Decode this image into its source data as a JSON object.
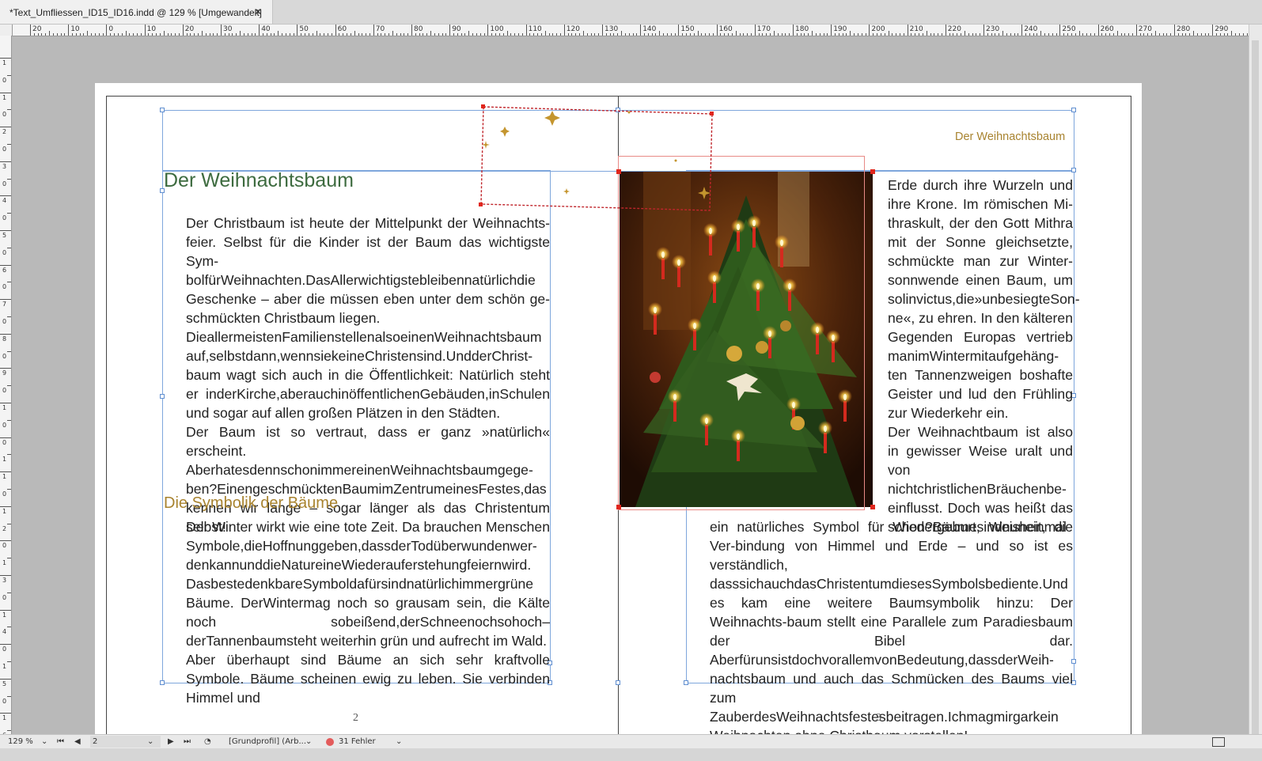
{
  "window": {
    "tab_title": "*Text_Umfliessen_ID15_ID16.indd @ 129 % [Umgewandelt]",
    "tab_close": "×"
  },
  "ruler": {
    "h_labels": [
      "20",
      "10",
      "0",
      "10",
      "20",
      "30",
      "40",
      "50",
      "60",
      "70",
      "80",
      "90",
      "100",
      "110",
      "120",
      "130",
      "140",
      "150",
      "160",
      "170",
      "180",
      "190",
      "200",
      "210",
      "220",
      "230",
      "240",
      "250",
      "260",
      "270",
      "280",
      "290"
    ],
    "v_labels": [
      "1",
      "0",
      "1",
      "0",
      "2",
      "0",
      "3",
      "0",
      "4",
      "0",
      "5",
      "0",
      "6",
      "0",
      "7",
      "0",
      "8",
      "0",
      "9",
      "0",
      "1",
      "0",
      "0",
      "1",
      "1",
      "0",
      "1",
      "2",
      "0",
      "1",
      "3",
      "0",
      "1",
      "4",
      "0",
      "1",
      "5",
      "0",
      "1",
      "6",
      "0"
    ]
  },
  "left_page": {
    "heading": "Der Weihnachtsbaum",
    "paragraphs": [
      "Der Christbaum ist heute der Mittelpunkt der Weihnachts-feier. Selbst für die Kinder ist der Baum das wichtigste Sym-bolfürWeihnachten.DasAllerwichtigstebleibennatürlichdie Geschenke – aber die müssen eben unter dem schön ge-schmückten Christbaum liegen.",
      "DieallermeistenFamilienstellenalsoeinenWeihnachtsbaum auf,selbstdann,wennsiekeineChristensind.UndderChrist-baum wagt sich auch in die Öffentlichkeit: Natürlich steht er inderKirche,aberauchinöffentlichenGebäuden,inSchulen und sogar auf allen großen Plätzen in den Städten.",
      "Der Baum ist so vertraut, dass er ganz »natürlich« erscheint. AberhatesdennschonimmereinenWeihnachtsbaumgege-ben?EinengeschmücktenBaumimZentrumeinesFestes,das kennen wir lange – sogar länger als das Christentum selbst!"
    ],
    "subheading": "Die Symbolik der Bäume",
    "paragraphs2": [
      "Der Winter wirkt wie eine tote Zeit. Da brauchen Menschen Symbole,dieHoffnunggeben,dassderTodüberwundenwer-denkannunddieNatureineWiederauferstehungfeiernwird. DasbestedenkbareSymboldafürsindnatürlichimmergrüne Bäume. DerWintermag noch so grausam sein, die Kälte noch sobeißend,derSchneenochsohoch–derTannenbaumsteht weiterhin grün und aufrecht im Wald.",
      "Aber überhaupt sind Bäume an sich sehr kraftvolle Symbole. Bäume scheinen ewig zu leben. Sie verbinden Himmel und"
    ],
    "page_number": "2"
  },
  "right_page": {
    "running_header": "Der Weihnachtsbaum",
    "column_text": [
      "Erde durch ihre Wurzeln und ihre Krone. Im römischen Mi-thraskult, der den Gott Mithra mit der Sonne gleichsetzte, schmückte man zur Winter-sonnwende einen Baum, um solinvictus,die»unbesiegteSon-ne«, zu ehren. In den kälteren Gegenden Europas vertrieb manimWintermitaufgehäng-ten Tannenzweigen boshafte Geister und lud den Frühling zur Wiederkehr ein.",
      "Der Weihnachtbaum ist also in gewisser Weise uralt und von nichtchristlichenBräuchenbe-einflusst. Doch was heißt das schon?Bäumesindnuneinmal"
    ],
    "wide_text": "ein natürliches Symbol für Wiedergeburt, Weisheit, die Ver-bindung von Himmel und Erde – und so ist es verständlich, dasssichauchdasChristentumdiesesSymbolsbediente.Und es kam eine weitere Baumsymbolik hinzu: Der Weihnachts-baum stellt eine Parallele zum Paradiesbaum der Bibel dar. AberfürunsistdochvorallemvonBedeutung,dassderWeih-nachtsbaum und auch das Schmücken des Baums viel zum ZauberdesWeihnachtsfestesbeitragen.Ichmagmirgarkein Weihnachten ohne Christbaum vorstellen!",
    "page_number": "3"
  },
  "statusbar": {
    "zoom": "129 %",
    "page_field": "2",
    "profile": "[Grundprofil] (Arb...",
    "errors": "31 Fehler"
  },
  "colors": {
    "heading_green": "#3d6b3f",
    "accent_gold": "#a8832f",
    "frame_blue": "#7ea6dc",
    "selection_red": "#e0261c"
  }
}
